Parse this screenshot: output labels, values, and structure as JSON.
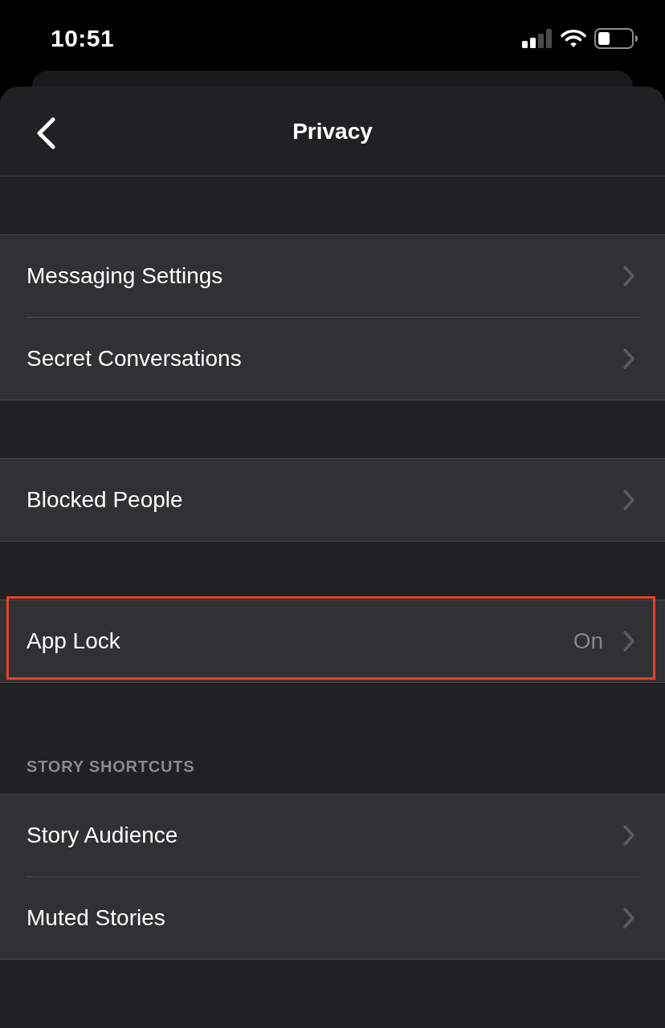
{
  "status_bar": {
    "time": "10:51"
  },
  "header": {
    "title": "Privacy"
  },
  "groups": [
    {
      "rows": [
        {
          "label": "Messaging Settings",
          "highlighted": false
        },
        {
          "label": "Secret Conversations",
          "highlighted": false
        }
      ]
    },
    {
      "rows": [
        {
          "label": "Blocked People",
          "highlighted": false
        }
      ]
    },
    {
      "rows": [
        {
          "label": "App Lock",
          "value": "On",
          "highlighted": true
        }
      ]
    },
    {
      "header": "STORY SHORTCUTS",
      "rows": [
        {
          "label": "Story Audience",
          "highlighted": false
        },
        {
          "label": "Muted Stories",
          "highlighted": false
        }
      ]
    }
  ]
}
